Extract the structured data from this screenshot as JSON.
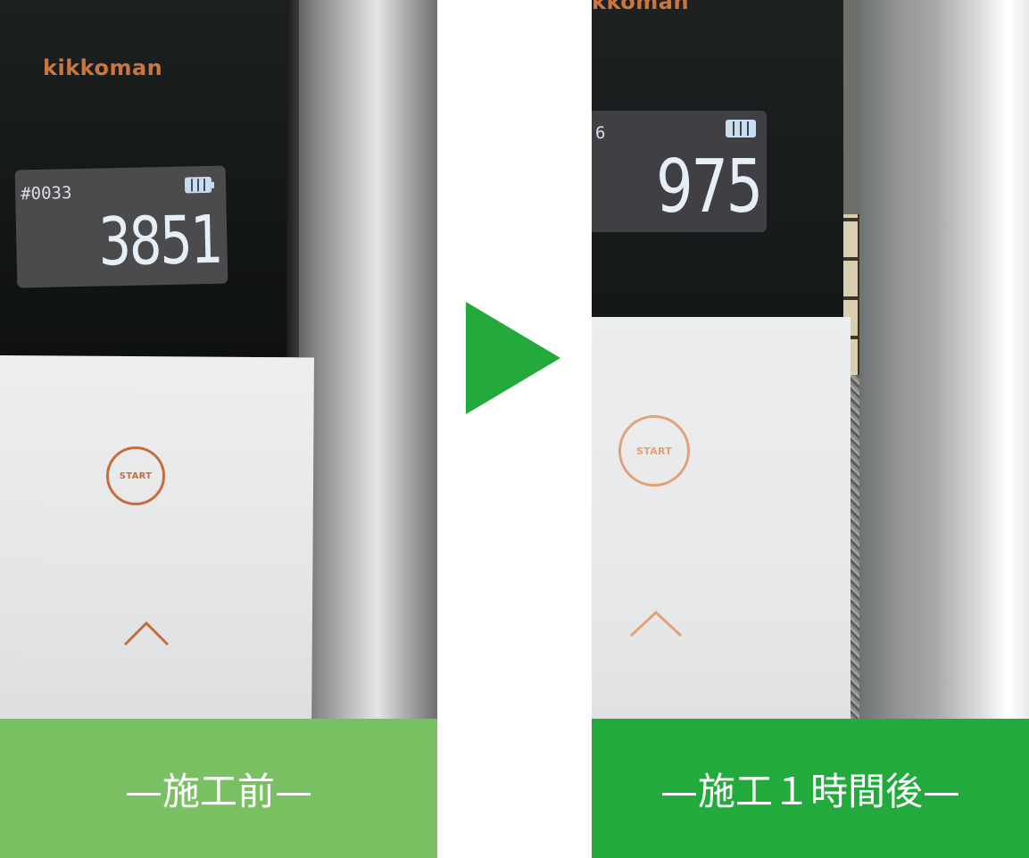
{
  "before": {
    "logo": "kikkoman",
    "id": "#0033",
    "value": "3851",
    "start_label": "START",
    "caption": "—施工前—"
  },
  "after": {
    "logo": "kkoman",
    "id": "6",
    "value": "975",
    "start_label": "START",
    "caption": "—施工１時間後—"
  },
  "colors": {
    "before_caption_bg": "#79c062",
    "after_caption_bg": "#23aa3d",
    "arrow": "#24a93c",
    "device_accent": "#c46e3b"
  }
}
